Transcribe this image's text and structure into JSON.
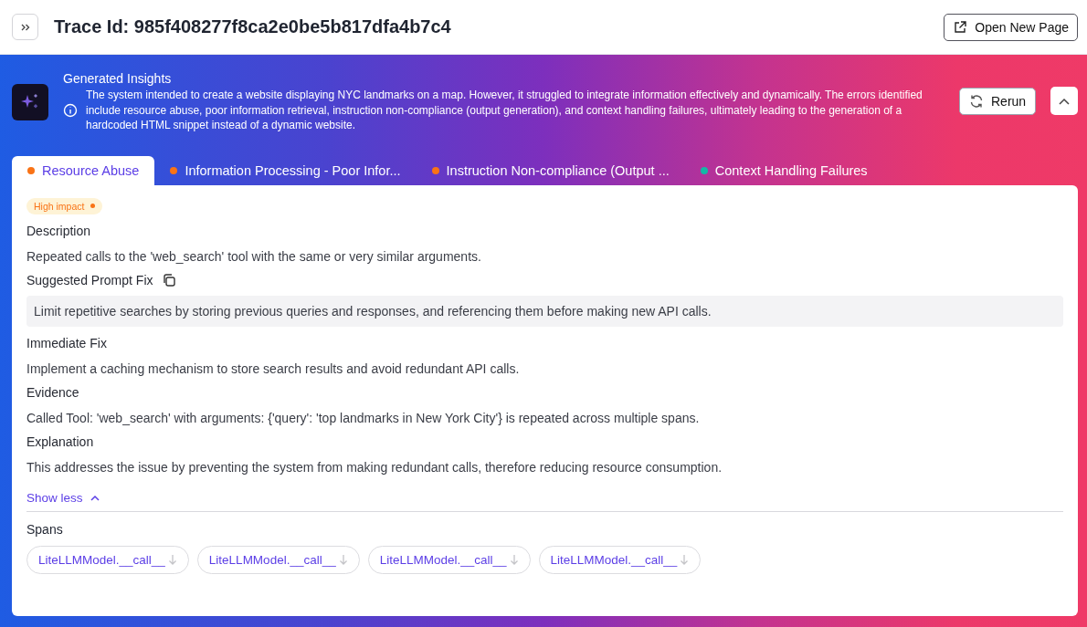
{
  "header": {
    "title": "Trace Id: 985f408277f8ca2e0be5b817dfa4b7c4",
    "open_button": "Open New Page"
  },
  "insights": {
    "title": "Generated Insights",
    "summary": "The system intended to create a website displaying NYC landmarks on a map. However, it struggled to integrate information effectively and dynamically. The errors identified include resource abuse, poor information retrieval, instruction non-compliance (output generation), and context handling failures, ultimately leading to the generation of a hardcoded HTML snippet instead of a dynamic website.",
    "rerun_button": "Rerun"
  },
  "tabs": [
    {
      "label": "Resource Abuse",
      "selected": true,
      "color": "#f97316"
    },
    {
      "label": "Information Processing - Poor Infor...",
      "selected": false,
      "color": "#f97316"
    },
    {
      "label": "Instruction Non-compliance (Output ...",
      "selected": false,
      "color": "#f97316"
    },
    {
      "label": "Context Handling Failures",
      "selected": false,
      "color": "#14b8a6"
    }
  ],
  "impact_badge": "High impact",
  "sections": [
    {
      "kind": "plain",
      "heading": "Description",
      "text": "Repeated calls to the 'web_search' tool with the same or very similar arguments."
    },
    {
      "kind": "prompt",
      "heading": "Suggested Prompt Fix",
      "text": "Limit repetitive searches by storing previous queries and responses, and referencing them before making new API calls."
    },
    {
      "kind": "plain",
      "heading": "Immediate Fix",
      "text": "Implement a caching mechanism to store search results and avoid redundant API calls."
    },
    {
      "kind": "plain",
      "heading": "Evidence",
      "text": "Called Tool: 'web_search' with arguments: {'query': 'top landmarks in New York City'} is repeated across multiple spans."
    },
    {
      "kind": "plain",
      "heading": "Explanation",
      "text": "This addresses the issue by preventing the system from making redundant calls, therefore reducing resource consumption."
    }
  ],
  "show_less": "Show less",
  "spans": {
    "title": "Spans",
    "items": [
      "LiteLLMModel.__call__",
      "LiteLLMModel.__call__",
      "LiteLLMModel.__call__",
      "LiteLLMModel.__call__"
    ]
  }
}
